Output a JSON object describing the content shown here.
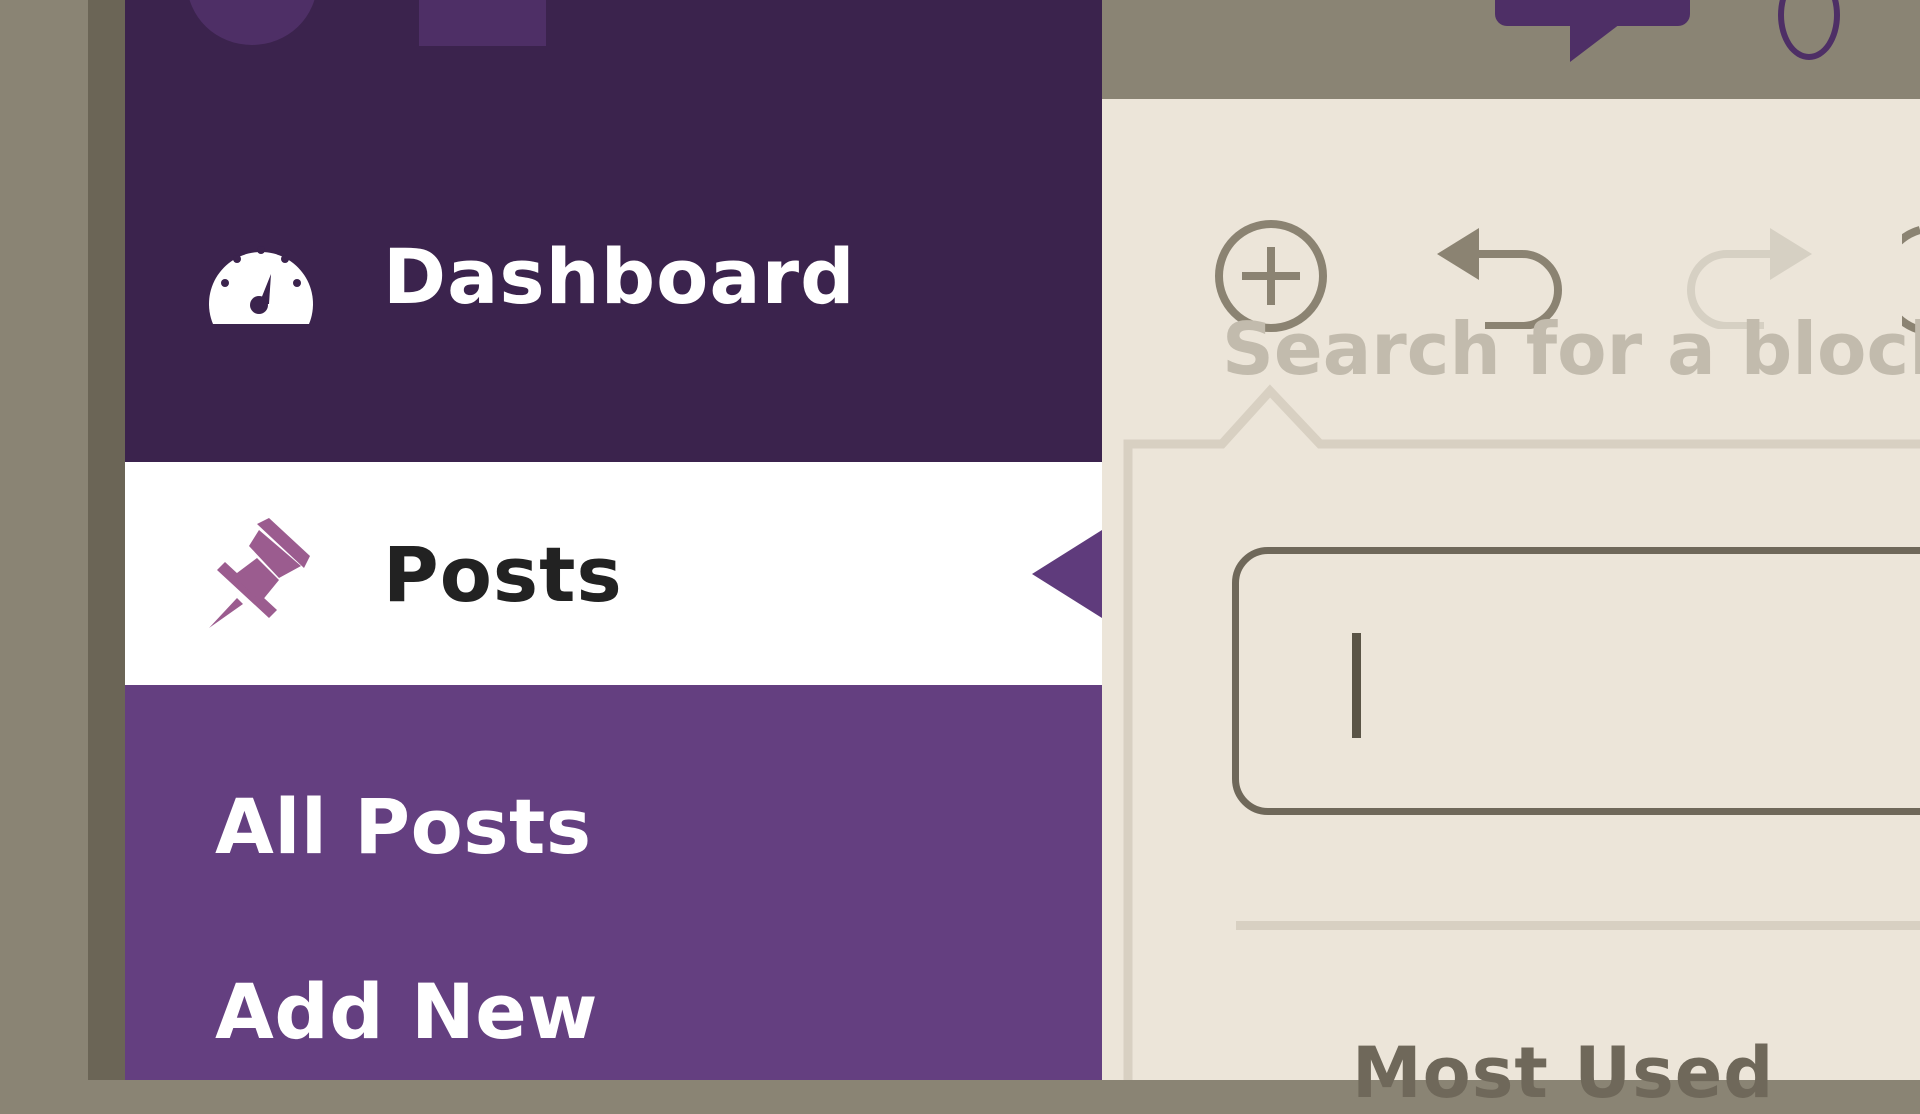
{
  "sidebar": {
    "items": [
      {
        "label": "Dashboard",
        "icon": "dashboard-gauge-icon"
      },
      {
        "label": "Posts",
        "icon": "pin-icon",
        "active": true
      }
    ],
    "submenu": [
      {
        "label": "All Posts"
      },
      {
        "label": "Add New"
      }
    ]
  },
  "editor": {
    "toolbar": [
      {
        "name": "add-block",
        "icon": "plus-circle-icon"
      },
      {
        "name": "undo",
        "icon": "undo-icon"
      },
      {
        "name": "redo",
        "icon": "redo-icon",
        "disabled": true
      }
    ],
    "search": {
      "placeholder": "Search for a block"
    },
    "section_title": "Most Used"
  },
  "colors": {
    "sidebar_bg": "#3b234d",
    "submenu_bg": "#643f80",
    "active_bg": "#ffffff",
    "pin_accent": "#9b5c8f",
    "editor_bg": "#ece5d9",
    "icon_gray": "#8b8372"
  }
}
